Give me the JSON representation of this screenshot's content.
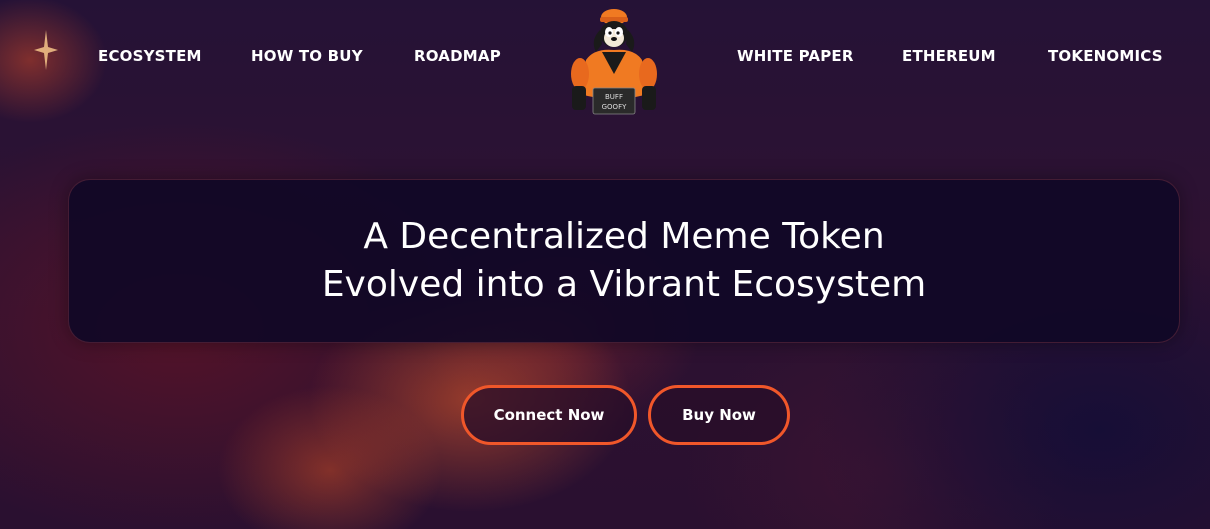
{
  "nav": {
    "left_items": [
      {
        "label": "ECOSYSTEM"
      },
      {
        "label": "HOW TO BUY"
      },
      {
        "label": "ROADMAP"
      }
    ],
    "right_items": [
      {
        "label": "WHITE PAPER"
      },
      {
        "label": "ETHEREUM"
      },
      {
        "label": "TOKENOMICS"
      }
    ],
    "logo": {
      "icon": "buff-goofy-mascot-icon",
      "sign_line1": "BUFF",
      "sign_line2": "GOOFY"
    }
  },
  "hero": {
    "line1": "A Decentralized Meme Token",
    "line2": "Evolved into a Vibrant Ecosystem"
  },
  "buttons": {
    "connect_label": "Connect Now",
    "buy_label": "Buy Now"
  },
  "colors": {
    "accent": "#f0572a",
    "card_bg": "#100826",
    "text": "#ffffff"
  }
}
